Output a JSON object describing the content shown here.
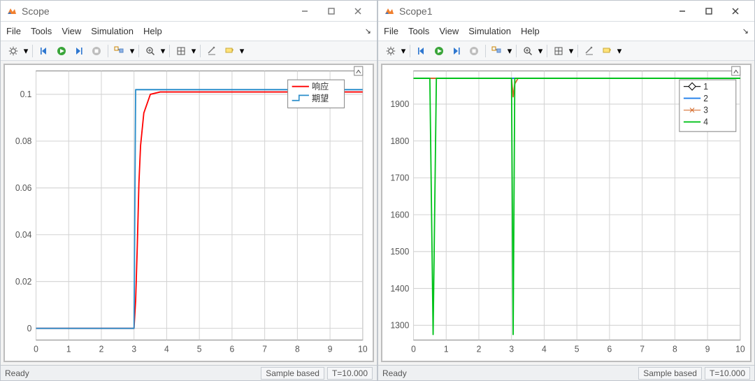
{
  "windows": [
    {
      "title": "Scope",
      "menu": [
        "File",
        "Tools",
        "View",
        "Simulation",
        "Help"
      ],
      "status_ready": "Ready",
      "status_mode": "Sample based",
      "status_time": "T=10.000",
      "x_ticks": [
        "0",
        "1",
        "2",
        "3",
        "4",
        "5",
        "6",
        "7",
        "8",
        "9",
        "10"
      ],
      "y_ticks": [
        "0",
        "0.02",
        "0.04",
        "0.06",
        "0.08",
        "0.1"
      ],
      "legend": [
        {
          "label": "响应",
          "color": "#ff0000",
          "style": "line"
        },
        {
          "label": "期望",
          "color": "#2b8ecb",
          "style": "step"
        }
      ]
    },
    {
      "title": "Scope1",
      "menu": [
        "File",
        "Tools",
        "View",
        "Simulation",
        "Help"
      ],
      "status_ready": "Ready",
      "status_mode": "Sample based",
      "status_time": "T=10.000",
      "x_ticks": [
        "0",
        "1",
        "2",
        "3",
        "4",
        "5",
        "6",
        "7",
        "8",
        "9",
        "10"
      ],
      "y_ticks": [
        "1300",
        "1400",
        "1500",
        "1600",
        "1700",
        "1800",
        "1900"
      ],
      "legend": [
        {
          "label": "1",
          "color": "#000000",
          "marker": "diamond"
        },
        {
          "label": "2",
          "color": "#1f7feb",
          "style": "line"
        },
        {
          "label": "3",
          "color": "#d46a2a",
          "marker": "x"
        },
        {
          "label": "4",
          "color": "#00c21a",
          "style": "line"
        }
      ]
    }
  ],
  "chart_data": [
    {
      "type": "line",
      "title": "",
      "xlabel": "",
      "ylabel": "",
      "xlim": [
        0,
        10
      ],
      "ylim": [
        -0.005,
        0.11
      ],
      "categories": [
        0,
        1,
        2,
        3,
        3.05,
        3.1,
        3.15,
        3.2,
        3.3,
        3.5,
        3.8,
        4,
        5,
        6,
        7,
        8,
        9,
        10
      ],
      "series": [
        {
          "name": "响应",
          "color": "#ff0000",
          "values": [
            0,
            0,
            0,
            0,
            0.012,
            0.035,
            0.062,
            0.078,
            0.092,
            0.1,
            0.101,
            0.101,
            0.101,
            0.101,
            0.101,
            0.101,
            0.101,
            0.101
          ]
        },
        {
          "name": "期望",
          "color": "#2b8ecb",
          "values": [
            0,
            0,
            0,
            0,
            0.102,
            0.102,
            0.102,
            0.102,
            0.102,
            0.102,
            0.102,
            0.102,
            0.102,
            0.102,
            0.102,
            0.102,
            0.102,
            0.102
          ]
        }
      ]
    },
    {
      "type": "line",
      "title": "",
      "xlabel": "",
      "ylabel": "",
      "xlim": [
        0,
        10
      ],
      "ylim": [
        1260,
        1990
      ],
      "categories": [
        0,
        0.5,
        0.6,
        0.7,
        0.8,
        1,
        2,
        2.9,
        3,
        3.05,
        3.1,
        3.2,
        4,
        5,
        6,
        7,
        8,
        9,
        10
      ],
      "series": [
        {
          "name": "1",
          "color": "#000000",
          "values": [
            1970,
            1970,
            1970,
            1970,
            1970,
            1970,
            1970,
            1970,
            1970,
            1970,
            1970,
            1970,
            1970,
            1970,
            1970,
            1970,
            1970,
            1970,
            1970
          ]
        },
        {
          "name": "2",
          "color": "#1f7feb",
          "values": [
            1970,
            1970,
            1970,
            1970,
            1970,
            1970,
            1970,
            1970,
            1970,
            1970,
            1970,
            1970,
            1970,
            1970,
            1970,
            1970,
            1970,
            1970,
            1970
          ]
        },
        {
          "name": "3",
          "color": "#d46a2a",
          "values": [
            1970,
            1970,
            1970,
            1970,
            1970,
            1970,
            1970,
            1970,
            1970,
            1920,
            1955,
            1970,
            1970,
            1970,
            1970,
            1970,
            1970,
            1970,
            1970
          ]
        },
        {
          "name": "4",
          "color": "#00c21a",
          "values": [
            1970,
            1970,
            1275,
            1970,
            1970,
            1970,
            1970,
            1970,
            1970,
            1275,
            1970,
            1970,
            1970,
            1970,
            1970,
            1970,
            1970,
            1970,
            1970
          ]
        }
      ]
    }
  ]
}
